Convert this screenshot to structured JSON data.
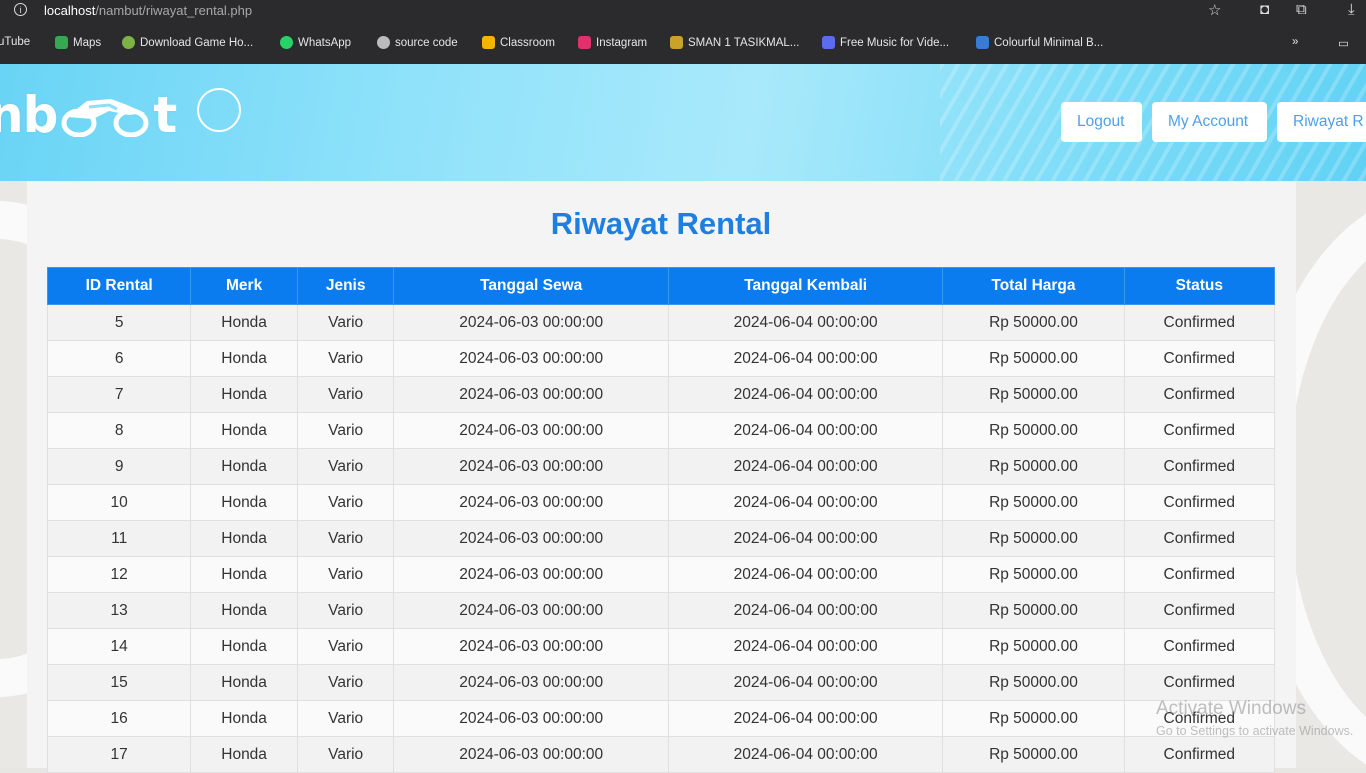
{
  "browser": {
    "url_host": "localhost",
    "url_path": "/nambut/riwayat_rental.php",
    "bookmarks": [
      {
        "label": "uTube",
        "icon": "youtube-icon",
        "color": "#ff0000"
      },
      {
        "label": "Maps",
        "icon": "maps-icon",
        "color": "#34a853"
      },
      {
        "label": "Download Game Ho...",
        "icon": "game-icon",
        "color": "#7cb342"
      },
      {
        "label": "WhatsApp",
        "icon": "whatsapp-icon",
        "color": "#25d366"
      },
      {
        "label": "source code",
        "icon": "globe-icon",
        "color": "#bbbbbb"
      },
      {
        "label": "Classroom",
        "icon": "classroom-icon",
        "color": "#f4b400"
      },
      {
        "label": "Instagram",
        "icon": "instagram-icon",
        "color": "#e1306c"
      },
      {
        "label": "SMAN 1 TASIKMAL...",
        "icon": "school-icon",
        "color": "#c9a227"
      },
      {
        "label": "Free Music for Vide...",
        "icon": "music-icon",
        "color": "#5b6cf0"
      },
      {
        "label": "Colourful Minimal B...",
        "icon": "canva-icon",
        "color": "#3a7bd5"
      }
    ]
  },
  "header": {
    "logo_text_left": "nb",
    "logo_text_right": "t",
    "nav": [
      {
        "label": "Logout"
      },
      {
        "label": "My Account"
      },
      {
        "label": "Riwayat R"
      }
    ]
  },
  "main": {
    "title": "Riwayat Rental",
    "columns": [
      "ID Rental",
      "Merk",
      "Jenis",
      "Tanggal Sewa",
      "Tanggal Kembali",
      "Total Harga",
      "Status"
    ],
    "rows": [
      [
        "5",
        "Honda",
        "Vario",
        "2024-06-03 00:00:00",
        "2024-06-04 00:00:00",
        "Rp 50000.00",
        "Confirmed"
      ],
      [
        "6",
        "Honda",
        "Vario",
        "2024-06-03 00:00:00",
        "2024-06-04 00:00:00",
        "Rp 50000.00",
        "Confirmed"
      ],
      [
        "7",
        "Honda",
        "Vario",
        "2024-06-03 00:00:00",
        "2024-06-04 00:00:00",
        "Rp 50000.00",
        "Confirmed"
      ],
      [
        "8",
        "Honda",
        "Vario",
        "2024-06-03 00:00:00",
        "2024-06-04 00:00:00",
        "Rp 50000.00",
        "Confirmed"
      ],
      [
        "9",
        "Honda",
        "Vario",
        "2024-06-03 00:00:00",
        "2024-06-04 00:00:00",
        "Rp 50000.00",
        "Confirmed"
      ],
      [
        "10",
        "Honda",
        "Vario",
        "2024-06-03 00:00:00",
        "2024-06-04 00:00:00",
        "Rp 50000.00",
        "Confirmed"
      ],
      [
        "11",
        "Honda",
        "Vario",
        "2024-06-03 00:00:00",
        "2024-06-04 00:00:00",
        "Rp 50000.00",
        "Confirmed"
      ],
      [
        "12",
        "Honda",
        "Vario",
        "2024-06-03 00:00:00",
        "2024-06-04 00:00:00",
        "Rp 50000.00",
        "Confirmed"
      ],
      [
        "13",
        "Honda",
        "Vario",
        "2024-06-03 00:00:00",
        "2024-06-04 00:00:00",
        "Rp 50000.00",
        "Confirmed"
      ],
      [
        "14",
        "Honda",
        "Vario",
        "2024-06-03 00:00:00",
        "2024-06-04 00:00:00",
        "Rp 50000.00",
        "Confirmed"
      ],
      [
        "15",
        "Honda",
        "Vario",
        "2024-06-03 00:00:00",
        "2024-06-04 00:00:00",
        "Rp 50000.00",
        "Confirmed"
      ],
      [
        "16",
        "Honda",
        "Vario",
        "2024-06-03 00:00:00",
        "2024-06-04 00:00:00",
        "Rp 50000.00",
        "Confirmed"
      ],
      [
        "17",
        "Honda",
        "Vario",
        "2024-06-03 00:00:00",
        "2024-06-04 00:00:00",
        "Rp 50000.00",
        "Confirmed"
      ]
    ]
  },
  "os_overlay": {
    "watermark_title": "Activate Windows",
    "watermark_sub": "Go to Settings to activate Windows."
  },
  "colors": {
    "accent": "#0b7cf0",
    "title": "#1e7fe0",
    "header_gradient_start": "#69d4f5",
    "header_gradient_end": "#61d2f4"
  }
}
